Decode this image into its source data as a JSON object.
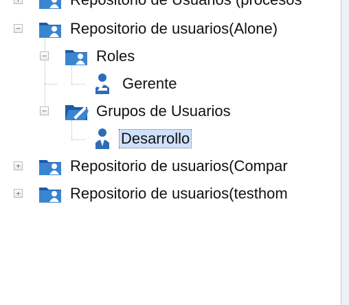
{
  "tree": {
    "nodes": [
      {
        "label": "Repositorio de Usuarios (procesos",
        "expander": "+",
        "icon": "folder-users-icon"
      },
      {
        "label": "Repositorio de usuarios(Alone)",
        "expander": "−",
        "icon": "folder-users-icon"
      },
      {
        "label": "Roles",
        "expander": "−",
        "icon": "folder-users-icon"
      },
      {
        "label": "Gerente",
        "icon": "role-user-icon"
      },
      {
        "label": "Grupos de Usuarios",
        "expander": "−",
        "icon": "folder-open-pencil-icon"
      },
      {
        "label": "Desarrollo",
        "icon": "user-icon",
        "selected": true
      },
      {
        "label": "Repositorio de usuarios(Compar",
        "expander": "+",
        "icon": "folder-users-icon"
      },
      {
        "label": "Repositorio de usuarios(testhom",
        "expander": "+",
        "icon": "folder-users-icon"
      }
    ]
  }
}
